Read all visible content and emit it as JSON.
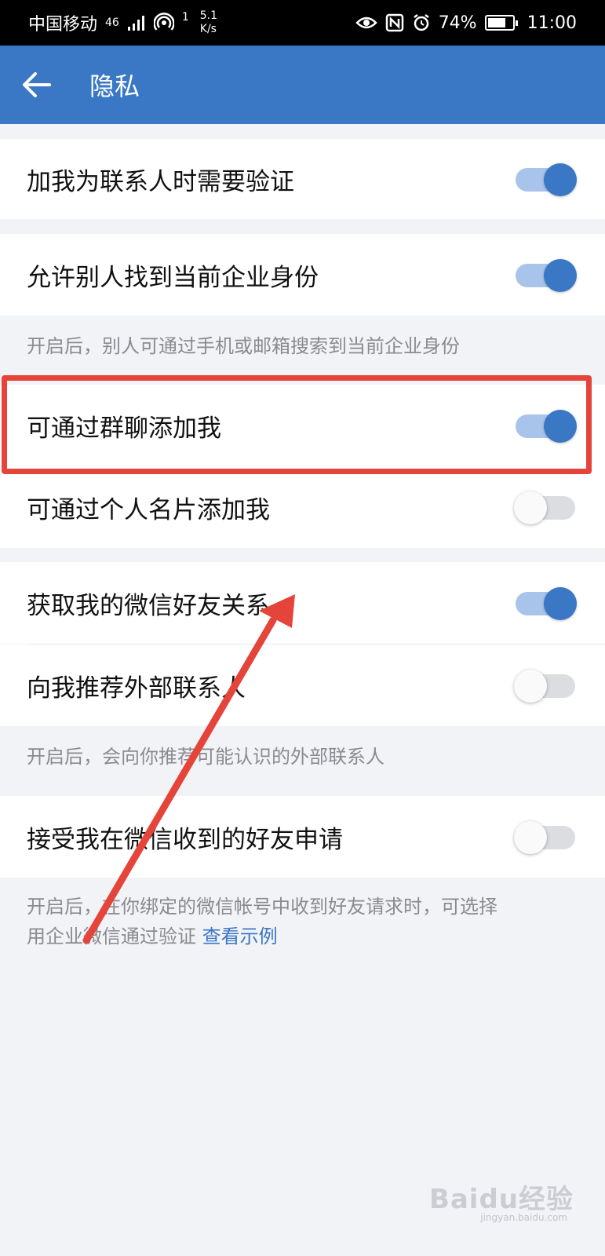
{
  "status_bar": {
    "carrier": "中国移动",
    "network": "4G",
    "signal_sub": "46",
    "hotspot_count": "1",
    "speed_value": "5.1",
    "speed_unit": "K/s",
    "battery": "74%",
    "time": "11:00"
  },
  "header": {
    "title": "隐私",
    "back_icon": "arrow-left-icon"
  },
  "settings": [
    {
      "label": "加我为联系人时需要验证",
      "enabled": true
    },
    {
      "label": "允许别人找到当前企业身份",
      "enabled": true
    },
    {
      "label": "可通过群聊添加我",
      "enabled": true
    },
    {
      "label": "可通过个人名片添加我",
      "enabled": false
    },
    {
      "label": "获取我的微信好友关系",
      "enabled": true
    },
    {
      "label": "向我推荐外部联系人",
      "enabled": false
    },
    {
      "label": "接受我在微信收到的好友申请",
      "enabled": false
    }
  ],
  "hints": {
    "find_identity": "开启后，别人可通过手机或邮箱搜索到当前企业身份",
    "recommend": "开启后，会向你推荐可能认识的外部联系人",
    "wechat_requests_line1": "开启后，在你绑定的微信帐号中收到好友请求时，可选择",
    "wechat_requests_line2": "用企业微信通过验证",
    "view_example_link": "查看示例"
  },
  "annotation": {
    "highlight_color": "#e5443a",
    "arrow_color": "#e5443a"
  },
  "watermark": {
    "text": "Baidu经验",
    "sub": "jingyan.baidu.com"
  },
  "colors": {
    "accent": "#3a77c5",
    "background": "#f2f3f7"
  }
}
